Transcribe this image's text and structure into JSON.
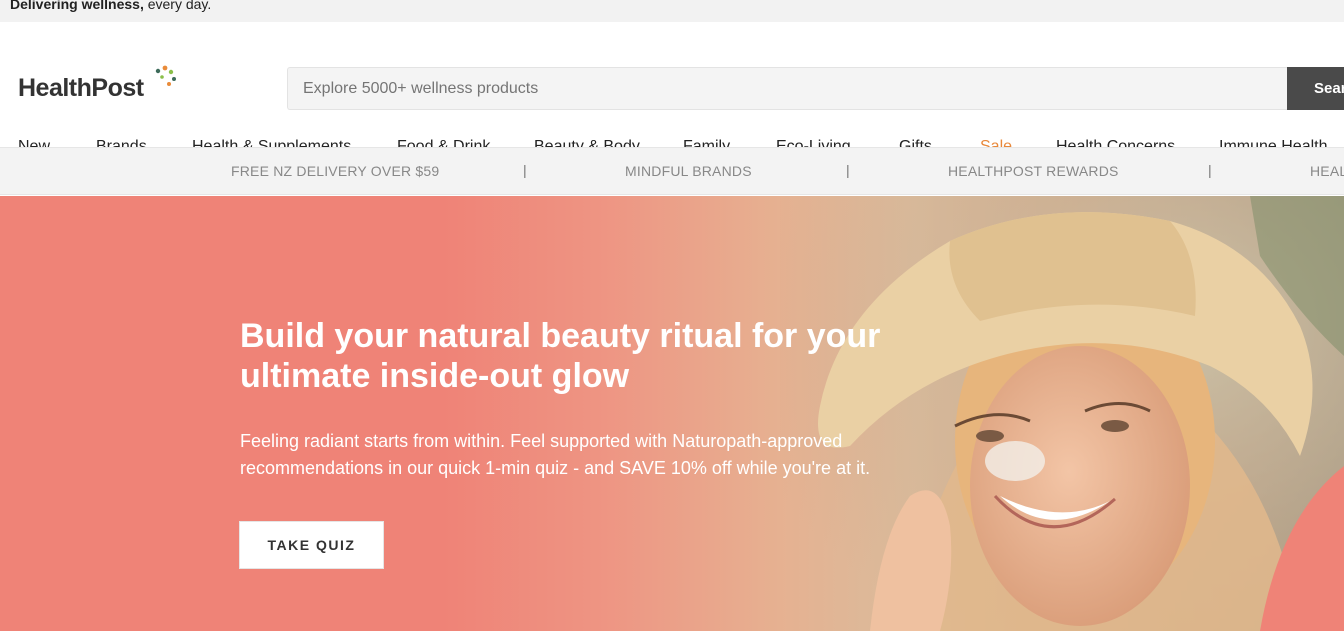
{
  "topbar": {
    "strong": "Delivering wellness,",
    "rest": " every day."
  },
  "header": {
    "logo": "HealthPost",
    "search_placeholder": "Explore 5000+ wellness products",
    "search_button": "Sear"
  },
  "nav": [
    "New",
    "Brands",
    "Health & Supplements",
    "Food & Drink",
    "Beauty & Body",
    "Family",
    "Eco-Living",
    "Gifts",
    "Sale",
    "Health Concerns",
    "Immune Health"
  ],
  "strip": [
    "FREE NZ DELIVERY OVER $59",
    "MINDFUL BRANDS",
    "HEALTHPOST REWARDS",
    "HEAL"
  ],
  "strip_separator": "|",
  "hero": {
    "title_line1": "Build your natural beauty ritual for your",
    "title_line2": "ultimate inside-out glow",
    "text_line1": "Feeling radiant starts from within. Feel supported with Naturopath-approved",
    "text_line2": "recommendations in our quick 1-min quiz - and SAVE 10% off while you're at it.",
    "cta": "TAKE QUIZ"
  },
  "colors": {
    "hero_coral": "#ef8377",
    "sale": "#e8883a",
    "search_button": "#4a4a4a"
  }
}
